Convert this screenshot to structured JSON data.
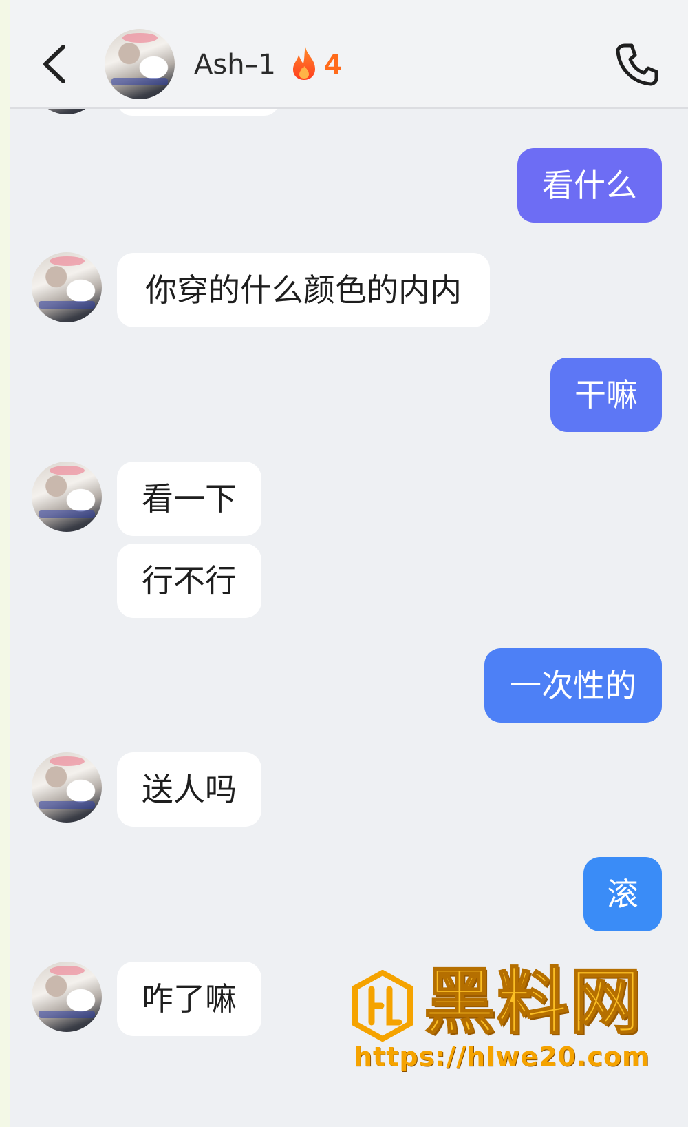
{
  "header": {
    "contact_name": "Ash–1",
    "streak_count": "4",
    "back_icon": "chevron-left-icon",
    "call_icon": "phone-icon",
    "streak_icon": "flame-icon"
  },
  "colors": {
    "incoming_bubble": "#ffffff",
    "outgoing_bubble_gradient": [
      "#6d6df4",
      "#5d77f5",
      "#4d80f6",
      "#3a8cf7"
    ],
    "streak": "#ff6a1a",
    "background": "#eef0f3"
  },
  "messages": [
    {
      "from": "me",
      "text": "看什么"
    },
    {
      "from": "them",
      "text": "你穿的什么颜色的内内"
    },
    {
      "from": "me",
      "text": "干嘛"
    },
    {
      "from": "them",
      "text": "看一下"
    },
    {
      "from": "them",
      "text": "行不行"
    },
    {
      "from": "me",
      "text": "一次性的"
    },
    {
      "from": "them",
      "text": "送人吗"
    },
    {
      "from": "me",
      "text": "滚"
    },
    {
      "from": "them",
      "text": "咋了嘛"
    }
  ],
  "watermark": {
    "title": "黑料网",
    "url": "https://hlwe20.com"
  }
}
